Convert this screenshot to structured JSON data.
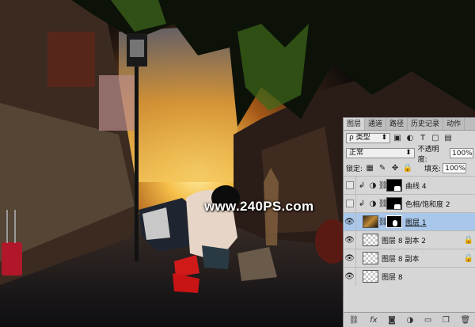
{
  "watermark": "www.240PS.com",
  "panel": {
    "tabs": [
      "图层",
      "通道",
      "路径",
      "历史记录",
      "动作"
    ],
    "filter_label": "ρ 类型",
    "blend_mode": "正常",
    "opacity_label": "不透明度:",
    "opacity_value": "100%",
    "lock_label": "锁定:",
    "fill_label": "填充:",
    "fill_value": "100%",
    "layers": [
      {
        "name": "曲线 4"
      },
      {
        "name": "色相/饱和度 2"
      },
      {
        "name": "图层 1"
      },
      {
        "name": "图层 8 副本 2"
      },
      {
        "name": "图层 8 副本"
      },
      {
        "name": "图层 8"
      }
    ],
    "footer_icons": [
      "link-icon",
      "fx-icon",
      "mask-icon",
      "adjustment-icon",
      "group-icon",
      "new-layer-icon",
      "trash-icon"
    ],
    "footer_fx": "fx"
  },
  "colors": {
    "selected_layer": "#a9c7ea",
    "panel_bg": "#d6d6d6",
    "sky_glow": "#f2b23a"
  }
}
